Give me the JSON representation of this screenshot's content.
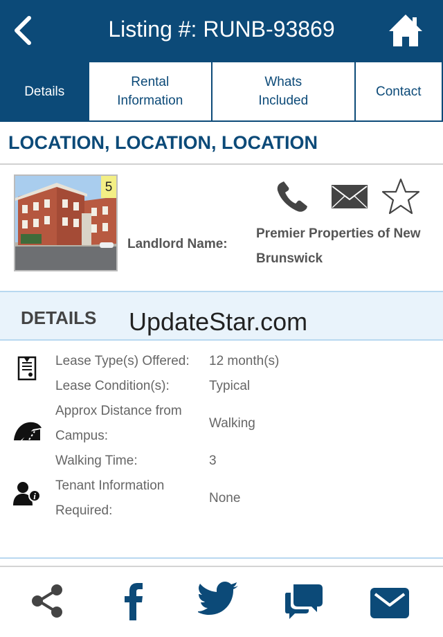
{
  "header": {
    "title": "Listing #: RUNB-93869",
    "back_icon": "chevron-left-icon",
    "home_icon": "home-icon"
  },
  "tabs": [
    {
      "label": "Details",
      "active": true
    },
    {
      "label": "Rental Information",
      "active": false
    },
    {
      "label": "Whats Included",
      "active": false
    },
    {
      "label": "Contact",
      "active": false
    }
  ],
  "headline": "LOCATION, LOCATION, LOCATION",
  "listing": {
    "photo_count": "5",
    "landlord_label": "Landlord Name:",
    "landlord_name": "Premier Properties of New Brunswick",
    "actions": [
      "phone-icon",
      "mail-icon",
      "favorite-star-icon"
    ]
  },
  "details_section": {
    "heading": "DETAILS",
    "watermark": "UpdateStar.com"
  },
  "details": [
    {
      "icon": "lease-document-icon",
      "label": "Lease Type(s) Offered:",
      "value": "12 month(s)"
    },
    {
      "icon": "",
      "label": "Lease Condition(s):",
      "value": "Typical"
    },
    {
      "icon": "distance-road-icon",
      "label": "Approx Distance from Campus:",
      "value": "Walking"
    },
    {
      "icon": "",
      "label": "Walking Time:",
      "value": "3"
    },
    {
      "icon": "tenant-info-icon",
      "label": "Tenant Information Required:",
      "value": "None"
    }
  ],
  "share_bar": [
    "share-icon",
    "facebook-icon",
    "twitter-icon",
    "chat-icon",
    "email-icon"
  ],
  "colors": {
    "primary": "#0c4a78",
    "band": "#e9f3fb",
    "badge": "#f3ef85"
  }
}
